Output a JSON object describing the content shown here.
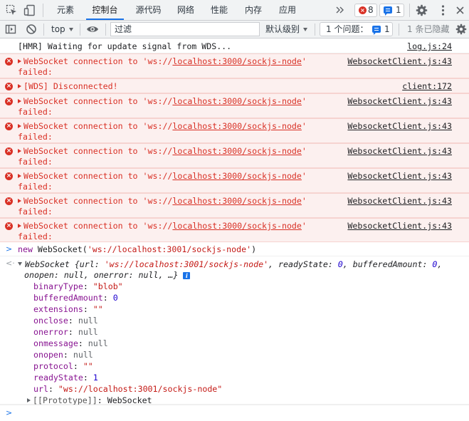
{
  "tabs": [
    "元素",
    "控制台",
    "源代码",
    "网络",
    "性能",
    "内存",
    "应用"
  ],
  "tab_active_index": 1,
  "badges": {
    "errors": "8",
    "messages": "1"
  },
  "toolbar": {
    "context": "top",
    "filter_placeholder": "过滤",
    "levels": "默认级别",
    "issues_label": "1 个问题：",
    "issues_count": "1",
    "hidden": "1 条已隐藏"
  },
  "messages": [
    {
      "type": "log",
      "text": "[HMR] Waiting for update signal from WDS...",
      "source": "log.js:24"
    },
    {
      "type": "error",
      "prefix": "WebSocket connection to 'ws://",
      "url": "localhost:3000/sockjs-node",
      "suffix": "'",
      "line2": "failed:",
      "source": "WebsocketClient.js:43"
    },
    {
      "type": "error",
      "prefix": "[WDS] Disconnected!",
      "url": "",
      "suffix": "",
      "line2": "",
      "source": "client:172"
    },
    {
      "type": "error",
      "prefix": "WebSocket connection to 'ws://",
      "url": "localhost:3000/sockjs-node",
      "suffix": "'",
      "line2": "failed:",
      "source": "WebsocketClient.js:43"
    },
    {
      "type": "error",
      "prefix": "WebSocket connection to 'ws://",
      "url": "localhost:3000/sockjs-node",
      "suffix": "'",
      "line2": "failed:",
      "source": "WebsocketClient.js:43"
    },
    {
      "type": "error",
      "prefix": "WebSocket connection to 'ws://",
      "url": "localhost:3000/sockjs-node",
      "suffix": "'",
      "line2": "failed:",
      "source": "WebsocketClient.js:43"
    },
    {
      "type": "error",
      "prefix": "WebSocket connection to 'ws://",
      "url": "localhost:3000/sockjs-node",
      "suffix": "'",
      "line2": "failed:",
      "source": "WebsocketClient.js:43"
    },
    {
      "type": "error",
      "prefix": "WebSocket connection to 'ws://",
      "url": "localhost:3000/sockjs-node",
      "suffix": "'",
      "line2": "failed:",
      "source": "WebsocketClient.js:43"
    },
    {
      "type": "error",
      "prefix": "WebSocket connection to 'ws://",
      "url": "localhost:3000/sockjs-node",
      "suffix": "'",
      "line2": "failed:",
      "source": "WebsocketClient.js:43"
    }
  ],
  "input_command": {
    "kw": "new",
    "rest": " WebSocket(",
    "arg": "'ws://localhost:3001/sockjs-node'",
    "close": ")"
  },
  "result": {
    "summary_name": "WebSocket ",
    "summary_open": "{url: ",
    "summary_url": "'ws://localhost:3001/sockjs-node'",
    "summary_ready_key": ", readyState: ",
    "summary_ready": "0",
    "summary_buffered_key": ", bufferedAmount: ",
    "summary_buffered": "0",
    "summary_tail": ",",
    "summary_line2": "onopen: null, onerror: null, …}",
    "props": [
      {
        "key": "binaryType",
        "value": "\"blob\"",
        "kind": "str"
      },
      {
        "key": "bufferedAmount",
        "value": "0",
        "kind": "num"
      },
      {
        "key": "extensions",
        "value": "\"\"",
        "kind": "str"
      },
      {
        "key": "onclose",
        "value": "null",
        "kind": "nul"
      },
      {
        "key": "onerror",
        "value": "null",
        "kind": "nul"
      },
      {
        "key": "onmessage",
        "value": "null",
        "kind": "nul"
      },
      {
        "key": "onopen",
        "value": "null",
        "kind": "nul"
      },
      {
        "key": "protocol",
        "value": "\"\"",
        "kind": "str"
      },
      {
        "key": "readyState",
        "value": "1",
        "kind": "num"
      },
      {
        "key": "url",
        "value": "\"ws://localhost:3001/sockjs-node\"",
        "kind": "str"
      }
    ],
    "prototype_key": "[[Prototype]]",
    "prototype_value": "WebSocket"
  },
  "colors": {
    "accent": "#1a73e8",
    "error": "#d93025",
    "error_bg": "#fcf0ef"
  }
}
